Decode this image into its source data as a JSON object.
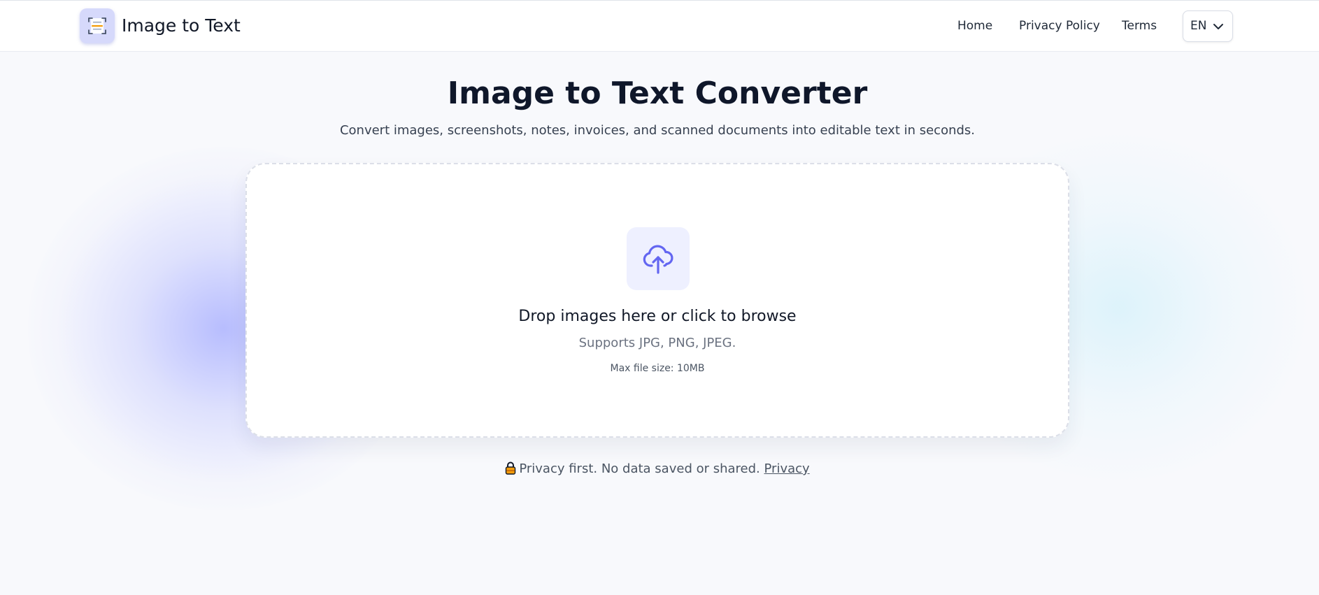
{
  "header": {
    "brand_name": "Image to Text",
    "logo_icon": "document-scan-icon",
    "nav": [
      {
        "label": "Home"
      },
      {
        "label": "Privacy Policy"
      },
      {
        "label": "Terms"
      }
    ],
    "language": {
      "code": "EN",
      "icon": "chevron-down-icon"
    }
  },
  "hero": {
    "title": "Image to Text Converter",
    "subtitle": "Convert images, screenshots, notes, invoices, and scanned documents into editable text in seconds."
  },
  "dropzone": {
    "icon": "cloud-upload-icon",
    "title": "Drop images here or click to browse",
    "supports": "Supports JPG, PNG, JPEG.",
    "max_size": "Max file size: 10MB"
  },
  "privacy_note": {
    "icon": "lock-icon",
    "text": "Privacy first. No data saved or shared.",
    "link_label": "Privacy"
  },
  "colors": {
    "accent": "#6366f1",
    "background": "#f8f9fc",
    "heading": "#0f172a"
  }
}
